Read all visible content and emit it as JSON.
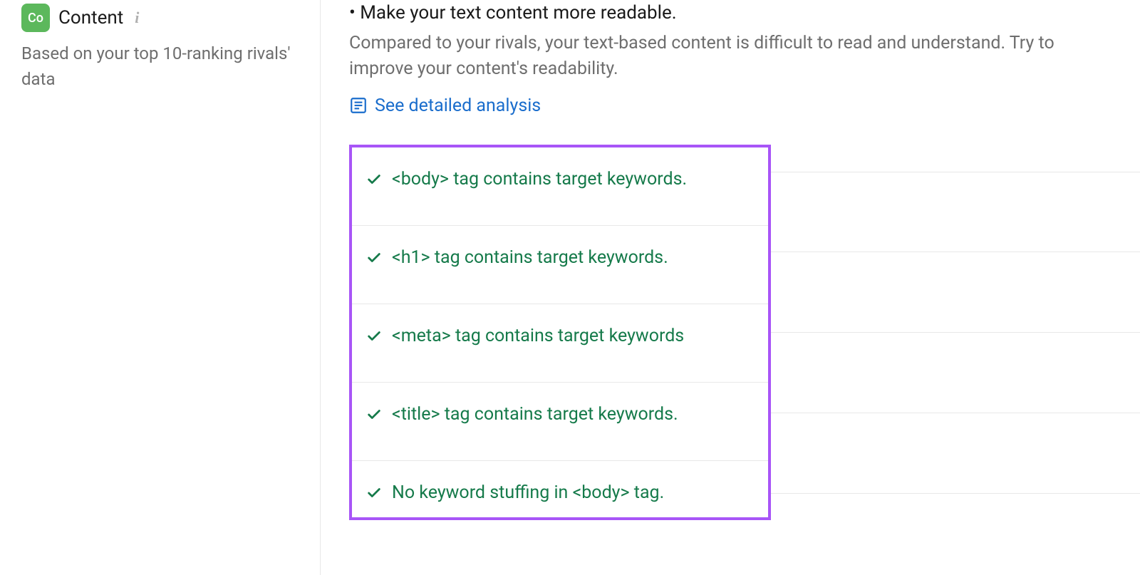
{
  "sidebar": {
    "badge": "Co",
    "title": "Content",
    "description": "Based on your top 10-ranking rivals' data"
  },
  "recommendation": {
    "title": "Make your text content more readable.",
    "description": "Compared to your rivals, your text-based content is difficult to read and understand. Try to improve your content's readability.",
    "link_label": "See detailed analysis"
  },
  "checks": [
    "<body> tag contains target keywords.",
    "<h1> tag contains target keywords.",
    "<meta> tag contains target keywords",
    "<title> tag contains target keywords.",
    "No keyword stuffing in <body> tag."
  ]
}
